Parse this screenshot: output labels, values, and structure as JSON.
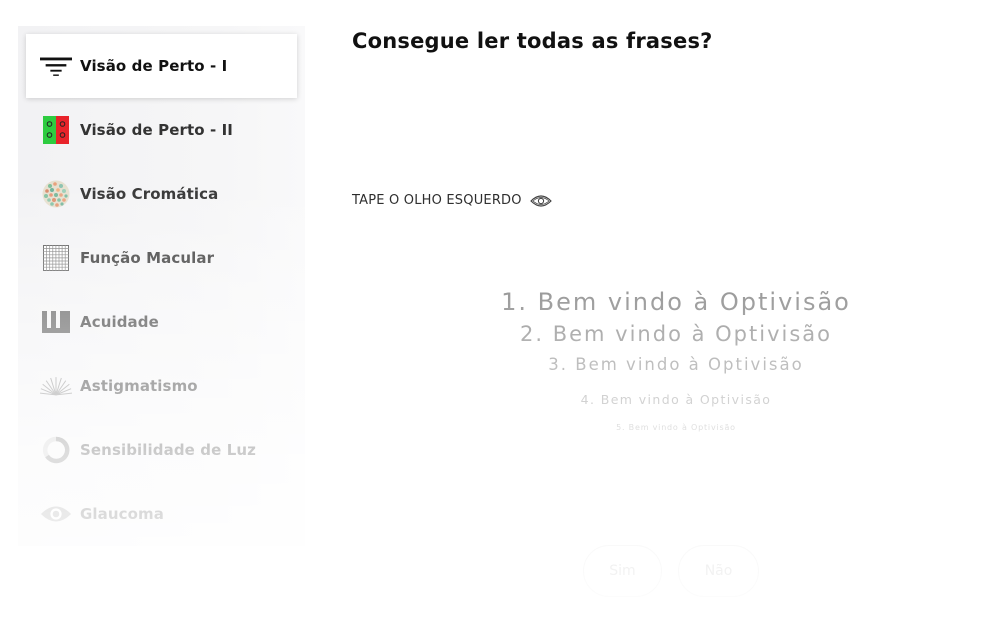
{
  "sidebar": {
    "items": [
      {
        "label": "Visão de Perto - I",
        "icon": "filter-lines-icon",
        "active": true
      },
      {
        "label": "Visão de Perto - II",
        "icon": "red-green-chart-icon"
      },
      {
        "label": "Visão Cromática",
        "icon": "color-dots-icon"
      },
      {
        "label": "Função Macular",
        "icon": "amsler-grid-icon"
      },
      {
        "label": "Acuidade",
        "icon": "acuity-chart-icon"
      },
      {
        "label": "Astigmatismo",
        "icon": "astigmatism-fan-icon"
      },
      {
        "label": "Sensibilidade de Luz",
        "icon": "contrast-ring-icon"
      },
      {
        "label": "Glaucoma",
        "icon": "eye-icon"
      }
    ]
  },
  "main": {
    "title": "Consegue ler todas as frases?",
    "instruction": "TAPE O OLHO ESQUERDO",
    "instruction_icon": "eye-outline-icon",
    "sentences": [
      "1. Bem vindo à Optivisão",
      "2. Bem vindo à Optivisão",
      "3. Bem vindo à Optivisão",
      "4. Bem vindo à Optivisão",
      "5. Bem vindo à Optivisão"
    ],
    "buttons": {
      "yes": "Sim",
      "no": "Não"
    }
  },
  "colors": {
    "red": "#e8232a",
    "green": "#2ecc40",
    "text": "#111111"
  }
}
